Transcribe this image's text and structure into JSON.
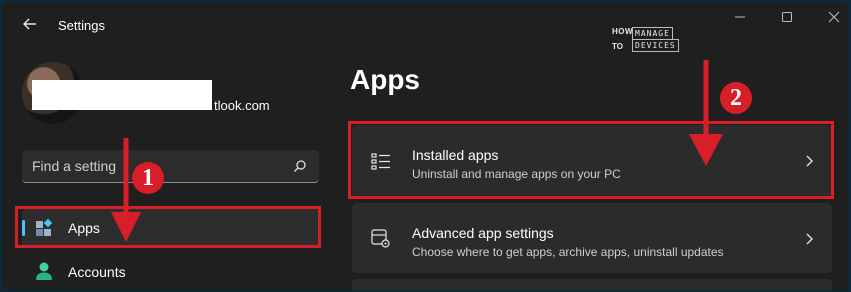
{
  "window": {
    "title": "Settings",
    "logo": {
      "line1": "HOW",
      "line2": "TO",
      "word1": "MANAGE",
      "word2": "DEVICES"
    }
  },
  "account": {
    "email_partial": "tlook.com"
  },
  "search": {
    "placeholder": "Find a setting"
  },
  "sidebar": {
    "items": [
      {
        "label": "Apps",
        "icon": "apps-icon",
        "selected": true
      },
      {
        "label": "Accounts",
        "icon": "accounts-icon",
        "selected": false
      }
    ]
  },
  "main": {
    "heading": "Apps",
    "cards": [
      {
        "title": "Installed apps",
        "subtitle": "Uninstall and manage apps on your PC",
        "icon": "installed-apps-icon"
      },
      {
        "title": "Advanced app settings",
        "subtitle": "Choose where to get apps, archive apps, uninstall updates",
        "icon": "advanced-app-settings-icon"
      }
    ]
  },
  "annotations": {
    "badge1": "1",
    "badge2": "2",
    "color": "#d81e28"
  },
  "colors": {
    "background": "#1f1f1f",
    "card": "#2b2b2b",
    "accent": "#4cc2ff",
    "highlight": "#d81e28"
  }
}
